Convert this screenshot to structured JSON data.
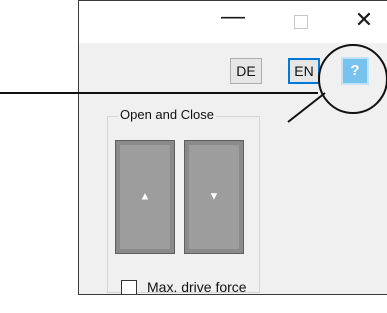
{
  "window": {
    "minimize_glyph": "—",
    "close_glyph": "✕"
  },
  "toolbar": {
    "de_label": "DE",
    "en_label": "EN",
    "help_label": "?"
  },
  "group": {
    "title": "Open and Close",
    "up_glyph": "▲",
    "down_glyph": "▼"
  },
  "options": {
    "max_drive_force_label": "Max. drive force",
    "max_drive_force_checked": false
  },
  "colors": {
    "help_button": "#77c3ee",
    "en_focus_border": "#0078d7",
    "move_button": "#9d9d9d"
  }
}
